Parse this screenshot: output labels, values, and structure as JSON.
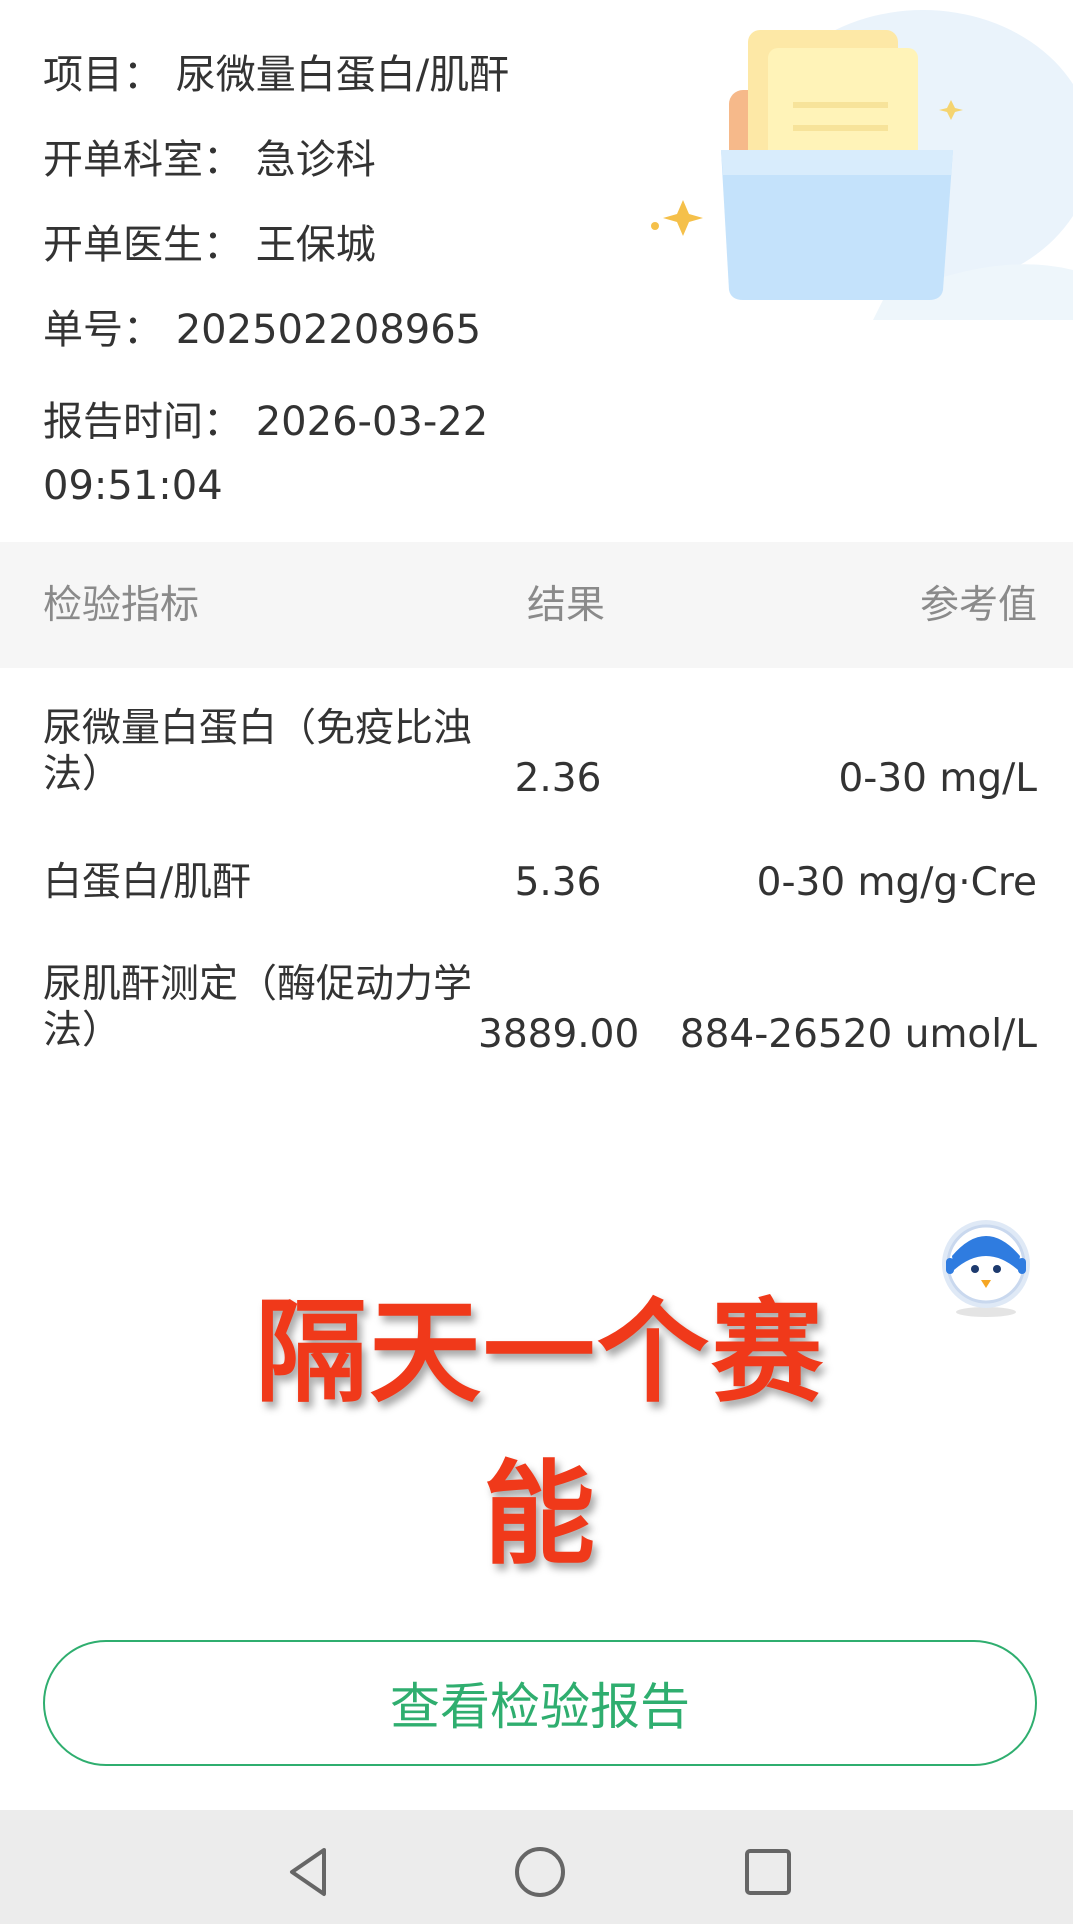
{
  "header": {
    "project_label": "项目：",
    "project_value": "尿微量白蛋白/肌酐",
    "department_label": "开单科室：",
    "department_value": "急诊科",
    "doctor_label": "开单医生：",
    "doctor_value": "王保城",
    "order_label": "单号：",
    "order_value": "202502208965",
    "time_label": "报告时间：",
    "time_value": "2026-03-22 09:51:04"
  },
  "table": {
    "columns": [
      "检验指标",
      "结果",
      "参考值"
    ],
    "rows": [
      {
        "name": "尿微量白蛋白（免疫比浊法）",
        "result": "2.36",
        "reference": "0-30 mg/L"
      },
      {
        "name": "白蛋白/肌酐",
        "result": "5.36",
        "reference": "0-30 mg/g·Cre"
      },
      {
        "name": "尿肌酐测定（酶促动力学法）",
        "result": "3889.00",
        "reference": "884-26520 umol/L"
      }
    ]
  },
  "overlay_text": "隔天一个赛能",
  "button": {
    "label": "查看检验报告"
  },
  "colors": {
    "accent": "#2fae6f",
    "overlay": "#f0391a",
    "header_bg": "#f6f6f6"
  },
  "icons": [
    "document-folder-illustration",
    "robot-mascot-icon",
    "back-icon",
    "home-icon",
    "recent-apps-icon"
  ]
}
